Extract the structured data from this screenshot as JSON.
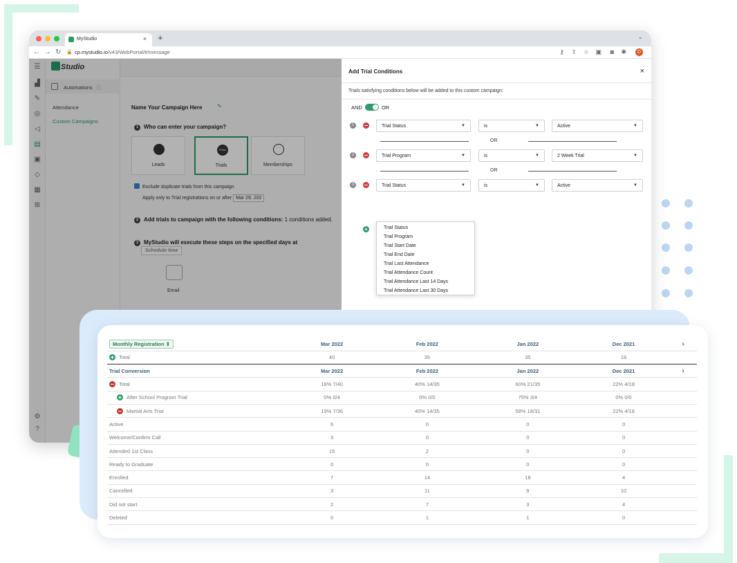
{
  "browser": {
    "tab_title": "MyStudio",
    "tab_close": "×",
    "new_tab": "+",
    "url_host": "cp.mystudio.io",
    "url_path": "/v43/WebPortal/#/message",
    "avatar_letter": "D"
  },
  "app": {
    "logo": "Studio",
    "automations_label": "Automations",
    "sidebar_links": [
      {
        "label": "Attendance",
        "active": false
      },
      {
        "label": "Custom Campaigns",
        "active": true
      }
    ],
    "campaign_name": "Name Your Campaign Here",
    "q1": "Who can enter your campaign?",
    "cards": [
      {
        "label": "Leads",
        "icon": "leads-icon"
      },
      {
        "label": "Trials",
        "icon": "trial-badge-icon",
        "badge": "TRIAL"
      },
      {
        "label": "Memberships",
        "icon": "person-icon"
      }
    ],
    "exclude_dup": "Exclude duplicate trials from this campaign",
    "apply_only": "Apply only to Trial registrations on or after",
    "apply_date": "Mar 29, 202",
    "q2": "Add trials to campaign with the following conditions:",
    "q2_count": "1 conditions added.",
    "q3": "MyStudio will execute these steps on the specified days at",
    "schedule_placeholder": "Schedule time",
    "email_label": "Email"
  },
  "panel": {
    "title": "Add Trial Conditions",
    "close": "×",
    "subtitle": "Trials satisfying conditions below will be added to this custom campaign:",
    "and_label": "AND",
    "or_label": "OR",
    "separator": "OR",
    "conditions": [
      {
        "field": "Trial Status",
        "operator": "is",
        "value": "Active"
      },
      {
        "field": "Trial Program",
        "operator": "is",
        "value": "2 Week Trial"
      },
      {
        "field": "Trial Status",
        "operator": "is",
        "value": "Active"
      }
    ],
    "dropdown_options": [
      "Trial Status",
      "Trial Program",
      "Trial Start Date",
      "Trial End Date",
      "Trial Last Attendance",
      "Trial Attendance Count",
      "Trial Attendance Last 14 Days",
      "Trial Attendance Last 30 Days"
    ]
  },
  "report": {
    "selector_label": "Monthly Registration",
    "months": [
      "Mar 2022",
      "Feb 2022",
      "Jan 2022",
      "Dec 2021"
    ],
    "total_label": "Total",
    "totals": [
      "40",
      "35",
      "35",
      "18"
    ],
    "conversion_label": "Trial Conversion",
    "conv_total": [
      "18% 7/40",
      "40% 14/35",
      "60% 21/35",
      "22% 4/18"
    ],
    "programs": [
      {
        "name": "After School Program Trial",
        "icon": "plus",
        "values": [
          "0% 0/4",
          "0% 0/0",
          "75% 3/4",
          "0% 0/0"
        ]
      },
      {
        "name": "Martial Arts Trial",
        "icon": "minus",
        "values": [
          "19% 7/36",
          "40% 14/35",
          "58% 18/31",
          "22% 4/18"
        ]
      }
    ],
    "statuses": [
      {
        "name": "Active",
        "values": [
          "6",
          "0",
          "0",
          "0"
        ]
      },
      {
        "name": "Welcome/Confirm Call",
        "values": [
          "3",
          "0",
          "0",
          "0"
        ]
      },
      {
        "name": "Attended 1st Class",
        "values": [
          "15",
          "2",
          "0",
          "0"
        ]
      },
      {
        "name": "Ready to Graduate",
        "values": [
          "0",
          "0",
          "0",
          "0"
        ]
      },
      {
        "name": "Enrolled",
        "values": [
          "7",
          "14",
          "18",
          "4"
        ]
      },
      {
        "name": "Cancelled",
        "values": [
          "3",
          "11",
          "9",
          "10"
        ]
      },
      {
        "name": "Did not start",
        "values": [
          "2",
          "7",
          "3",
          "4"
        ]
      },
      {
        "name": "Deleted",
        "values": [
          "0",
          "1",
          "1",
          "0"
        ]
      }
    ]
  },
  "colors": {
    "accent_green": "#2a9d66",
    "minus_red": "#d23c3c",
    "mint": "#d4f5e8",
    "report_bg": "#dcebfb"
  }
}
